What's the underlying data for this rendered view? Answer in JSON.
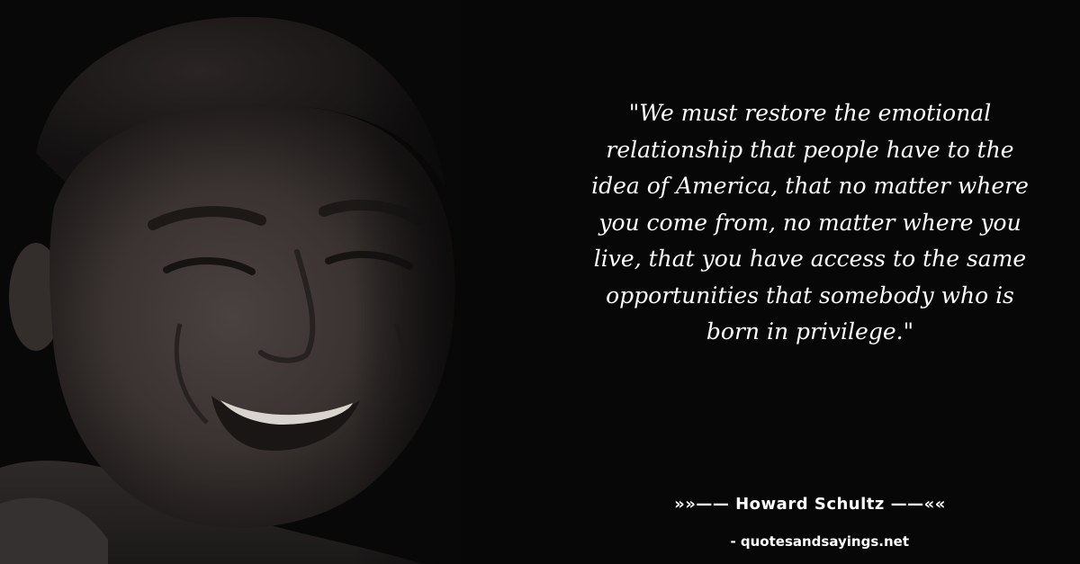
{
  "quote": {
    "lines": [
      "\"We must restore the emotional",
      "relationship that people have to the",
      "idea of America, that no matter where",
      "you come from, no matter where you",
      "live, that you have access to the same",
      "opportunities that somebody who is",
      "born in privilege.\""
    ]
  },
  "author": {
    "text": "»»—— Howard Schultz ——««"
  },
  "source": {
    "text": "- quotesandsayings.net"
  },
  "colors": {
    "background": "#070707",
    "text": "#ffffff",
    "portrait_tone": "#3a3432"
  },
  "image": {
    "subject": "portrait-photo"
  }
}
